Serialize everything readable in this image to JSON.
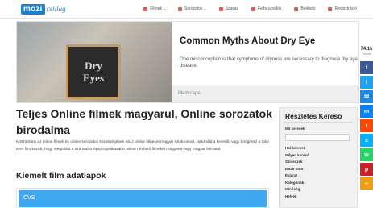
{
  "header": {
    "logo_brand": "mozi",
    "logo_suffix": "csillag",
    "nav": [
      {
        "label": "Filmek",
        "icon": "film-icon",
        "dropdown": true,
        "color": "#e05a4b"
      },
      {
        "label": "Sorozatok",
        "icon": "tv-icon",
        "dropdown": true,
        "color": "#e05a4b"
      },
      {
        "label": "Szavaz",
        "icon": "star-icon",
        "dropdown": false,
        "color": "#e05a4b"
      },
      {
        "label": "Felhasználók",
        "icon": "users-icon",
        "dropdown": false,
        "color": "#e05a4b"
      },
      {
        "label": "Belépés",
        "icon": "login-icon",
        "dropdown": false,
        "color": "#e05a4b"
      },
      {
        "label": "Regisztráció",
        "icon": "register-icon",
        "dropdown": false,
        "color": "#e05a4b"
      }
    ]
  },
  "ad": {
    "sign_word1": "Dry",
    "sign_word2": "Eyes",
    "headline": "Common Myths About Dry Eye",
    "text": "One misconception is that symptoms of dryness are necessary to diagnose dry eye disease.",
    "source": "Medscape"
  },
  "share": {
    "count": "74.1k",
    "label": "Shares",
    "buttons": [
      {
        "name": "facebook-share-button",
        "icon": "facebook-icon",
        "glyph": "f",
        "color": "#3b5998"
      },
      {
        "name": "twitter-share-button",
        "icon": "twitter-icon",
        "glyph": "t",
        "color": "#1da1f2"
      },
      {
        "name": "email-share-button",
        "icon": "email-icon",
        "glyph": "✉",
        "color": "#1e88e5"
      },
      {
        "name": "messenger-share-button",
        "icon": "messenger-icon",
        "glyph": "m",
        "color": "#0084ff"
      },
      {
        "name": "reddit-share-button",
        "icon": "reddit-icon",
        "glyph": "r",
        "color": "#ff4500"
      },
      {
        "name": "sms-share-button",
        "icon": "sms-icon",
        "glyph": "s",
        "color": "#00b2ff"
      },
      {
        "name": "whatsapp-share-button",
        "icon": "whatsapp-icon",
        "glyph": "w",
        "color": "#25d366"
      },
      {
        "name": "pinterest-share-button",
        "icon": "pinterest-icon",
        "glyph": "p",
        "color": "#cb2027"
      },
      {
        "name": "more-share-button",
        "icon": "plus-icon",
        "glyph": "+",
        "color": "#f39c12"
      }
    ]
  },
  "main": {
    "title": "Teljes Online filmek magyarul, Online sorozatok birodalma",
    "intro": "Köszöntünk az online filmek és online sorozatok közösségében nézz online filmeket magyar szinkronnal. Használd a keresőt, vagy böngéssz a több ezer film között, hogy megtaláld a számodra legszimpatikusabb online nézhető filmeket magyarul vagy magyar felirattal.",
    "featured_title": "Kiemelt film adatlapok",
    "featured_card_label": "CVS"
  },
  "search_panel": {
    "title": "Részletes Kereső",
    "title_search_label": "Mit keresek",
    "title_search_placeholder": "",
    "fields": [
      "Hol keresek",
      "Milyen kereső",
      "Színészek",
      "IMDB pont",
      "Évjárat",
      "Kategóriák",
      "Minőség",
      "Helyek"
    ]
  }
}
